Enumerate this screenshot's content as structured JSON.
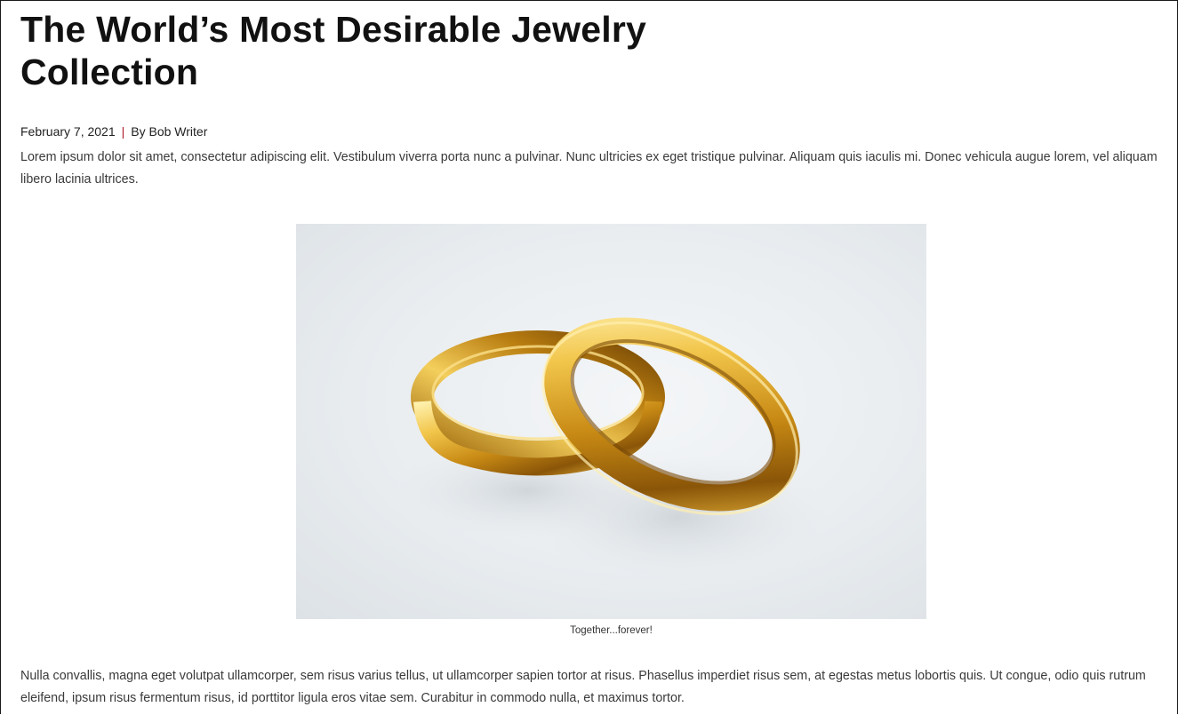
{
  "article": {
    "title": "The World’s Most Desirable Jewelry Collection",
    "date": "February 7, 2021",
    "separator": "|",
    "byline": "By Bob Writer",
    "paragraph_1": "Lorem ipsum dolor sit amet, consectetur adipiscing elit. Vestibulum viverra porta nunc a pulvinar. Nunc ultricies ex eget tristique pulvinar. Aliquam quis iaculis mi. Donec vehicula augue lorem, vel aliquam libero lacinia ultrices.",
    "image": {
      "subject": "two-gold-wedding-rings",
      "caption": "Together...forever!"
    },
    "paragraph_2": "Nulla convallis, magna eget volutpat ullamcorper, sem risus varius tellus, ut ullamcorper sapien tortor at risus. Phasellus imperdiet risus sem, at egestas metus lobortis quis. Ut congue, odio quis rutrum eleifend, ipsum risus fermentum risus, id porttitor ligula eros vitae sem. Curabitur in commodo nulla, et maximus tortor."
  },
  "colors": {
    "separator_accent": "#b01c2e",
    "gold_light": "#f7d56a",
    "gold_mid": "#d39a1e",
    "gold_dark": "#7a4a06"
  }
}
